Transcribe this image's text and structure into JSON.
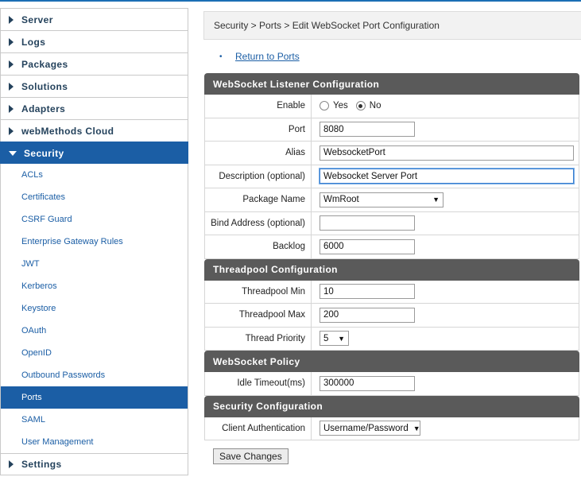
{
  "sidebar": {
    "top_items": [
      {
        "label": "Server"
      },
      {
        "label": "Logs"
      },
      {
        "label": "Packages"
      },
      {
        "label": "Solutions"
      },
      {
        "label": "Adapters"
      },
      {
        "label": "webMethods Cloud"
      }
    ],
    "active_item": {
      "label": "Security"
    },
    "sub_items": [
      {
        "label": "ACLs"
      },
      {
        "label": "Certificates"
      },
      {
        "label": "CSRF Guard"
      },
      {
        "label": "Enterprise Gateway Rules"
      },
      {
        "label": "JWT"
      },
      {
        "label": "Kerberos"
      },
      {
        "label": "Keystore"
      },
      {
        "label": "OAuth"
      },
      {
        "label": "OpenID"
      },
      {
        "label": "Outbound Passwords"
      },
      {
        "label": "Ports"
      },
      {
        "label": "SAML"
      },
      {
        "label": "User Management"
      }
    ],
    "selected_sub": "Ports",
    "bottom_item": {
      "label": "Settings"
    }
  },
  "breadcrumb": "Security > Ports > Edit WebSocket Port Configuration",
  "return_link": "Return to Ports",
  "return_bullet": "•",
  "sections": {
    "listener": {
      "title": "WebSocket Listener Configuration",
      "enable_label": "Enable",
      "enable_yes": "Yes",
      "enable_no": "No",
      "port_label": "Port",
      "port_value": "8080",
      "alias_label": "Alias",
      "alias_value": "WebsocketPort",
      "description_label": "Description (optional)",
      "description_value": "Websocket Server Port",
      "package_label": "Package Name",
      "package_value": "WmRoot",
      "bind_label": "Bind Address (optional)",
      "bind_value": "",
      "backlog_label": "Backlog",
      "backlog_value": "6000"
    },
    "threadpool": {
      "title": "Threadpool Configuration",
      "min_label": "Threadpool Min",
      "min_value": "10",
      "max_label": "Threadpool Max",
      "max_value": "200",
      "priority_label": "Thread Priority",
      "priority_value": "5"
    },
    "policy": {
      "title": "WebSocket Policy",
      "idle_label": "Idle Timeout(ms)",
      "idle_value": "300000"
    },
    "security": {
      "title": "Security Configuration",
      "client_auth_label": "Client Authentication",
      "client_auth_value": "Username/Password"
    }
  },
  "save_button": "Save Changes",
  "arrow_glyph": "▼"
}
